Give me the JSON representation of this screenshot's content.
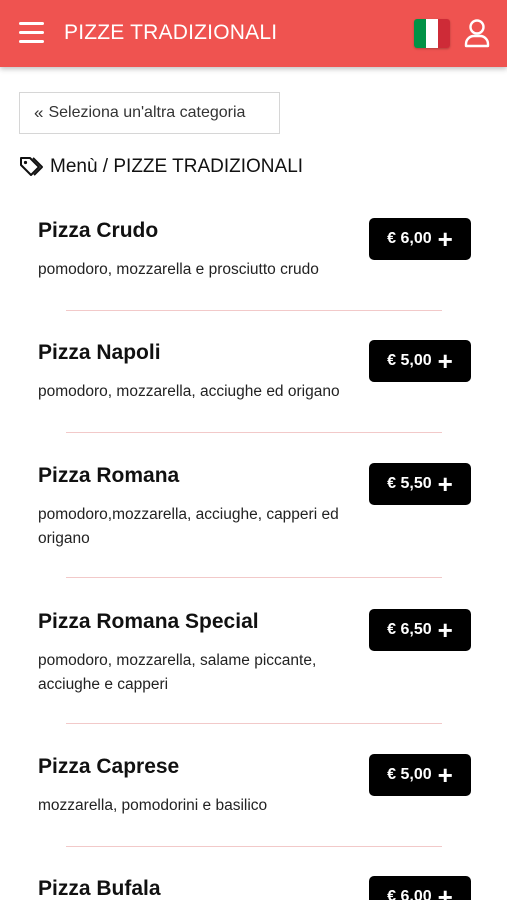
{
  "header": {
    "title": "PIZZE TRADIZIONALI",
    "language": "Italiano"
  },
  "back_button": {
    "chevron": "«",
    "label": "Seleziona un'altra categoria"
  },
  "breadcrumb": {
    "text": "Menù / PIZZE TRADIZIONALI"
  },
  "items": [
    {
      "name": "Pizza Crudo",
      "description": "pomodoro, mozzarella e prosciutto crudo",
      "price": "€ 6,00"
    },
    {
      "name": "Pizza Napoli",
      "description": "pomodoro, mozzarella, acciughe ed origano",
      "price": "€ 5,00"
    },
    {
      "name": "Pizza Romana",
      "description": "pomodoro,mozzarella, acciughe, capperi ed origano",
      "price": "€ 5,50"
    },
    {
      "name": "Pizza Romana Special",
      "description": "pomodoro, mozzarella, salame piccante, acciughe e capperi",
      "price": "€ 6,50"
    },
    {
      "name": "Pizza Caprese",
      "description": "mozzarella, pomodorini e basilico",
      "price": "€ 5,00"
    },
    {
      "name": "Pizza Bufala",
      "description": "",
      "price": "€ 6,00"
    }
  ],
  "icons": {
    "menu": "hamburger-menu-icon",
    "flag": "italian-flag-icon",
    "user": "user-icon",
    "tag": "tag-icon",
    "plus": "plus-icon"
  },
  "colors": {
    "header_bg": "#ef5350",
    "price_button_bg": "#000000",
    "divider": "#f2c9c9",
    "flag_green": "#009246",
    "flag_white": "#ffffff",
    "flag_red": "#ce2b37"
  }
}
